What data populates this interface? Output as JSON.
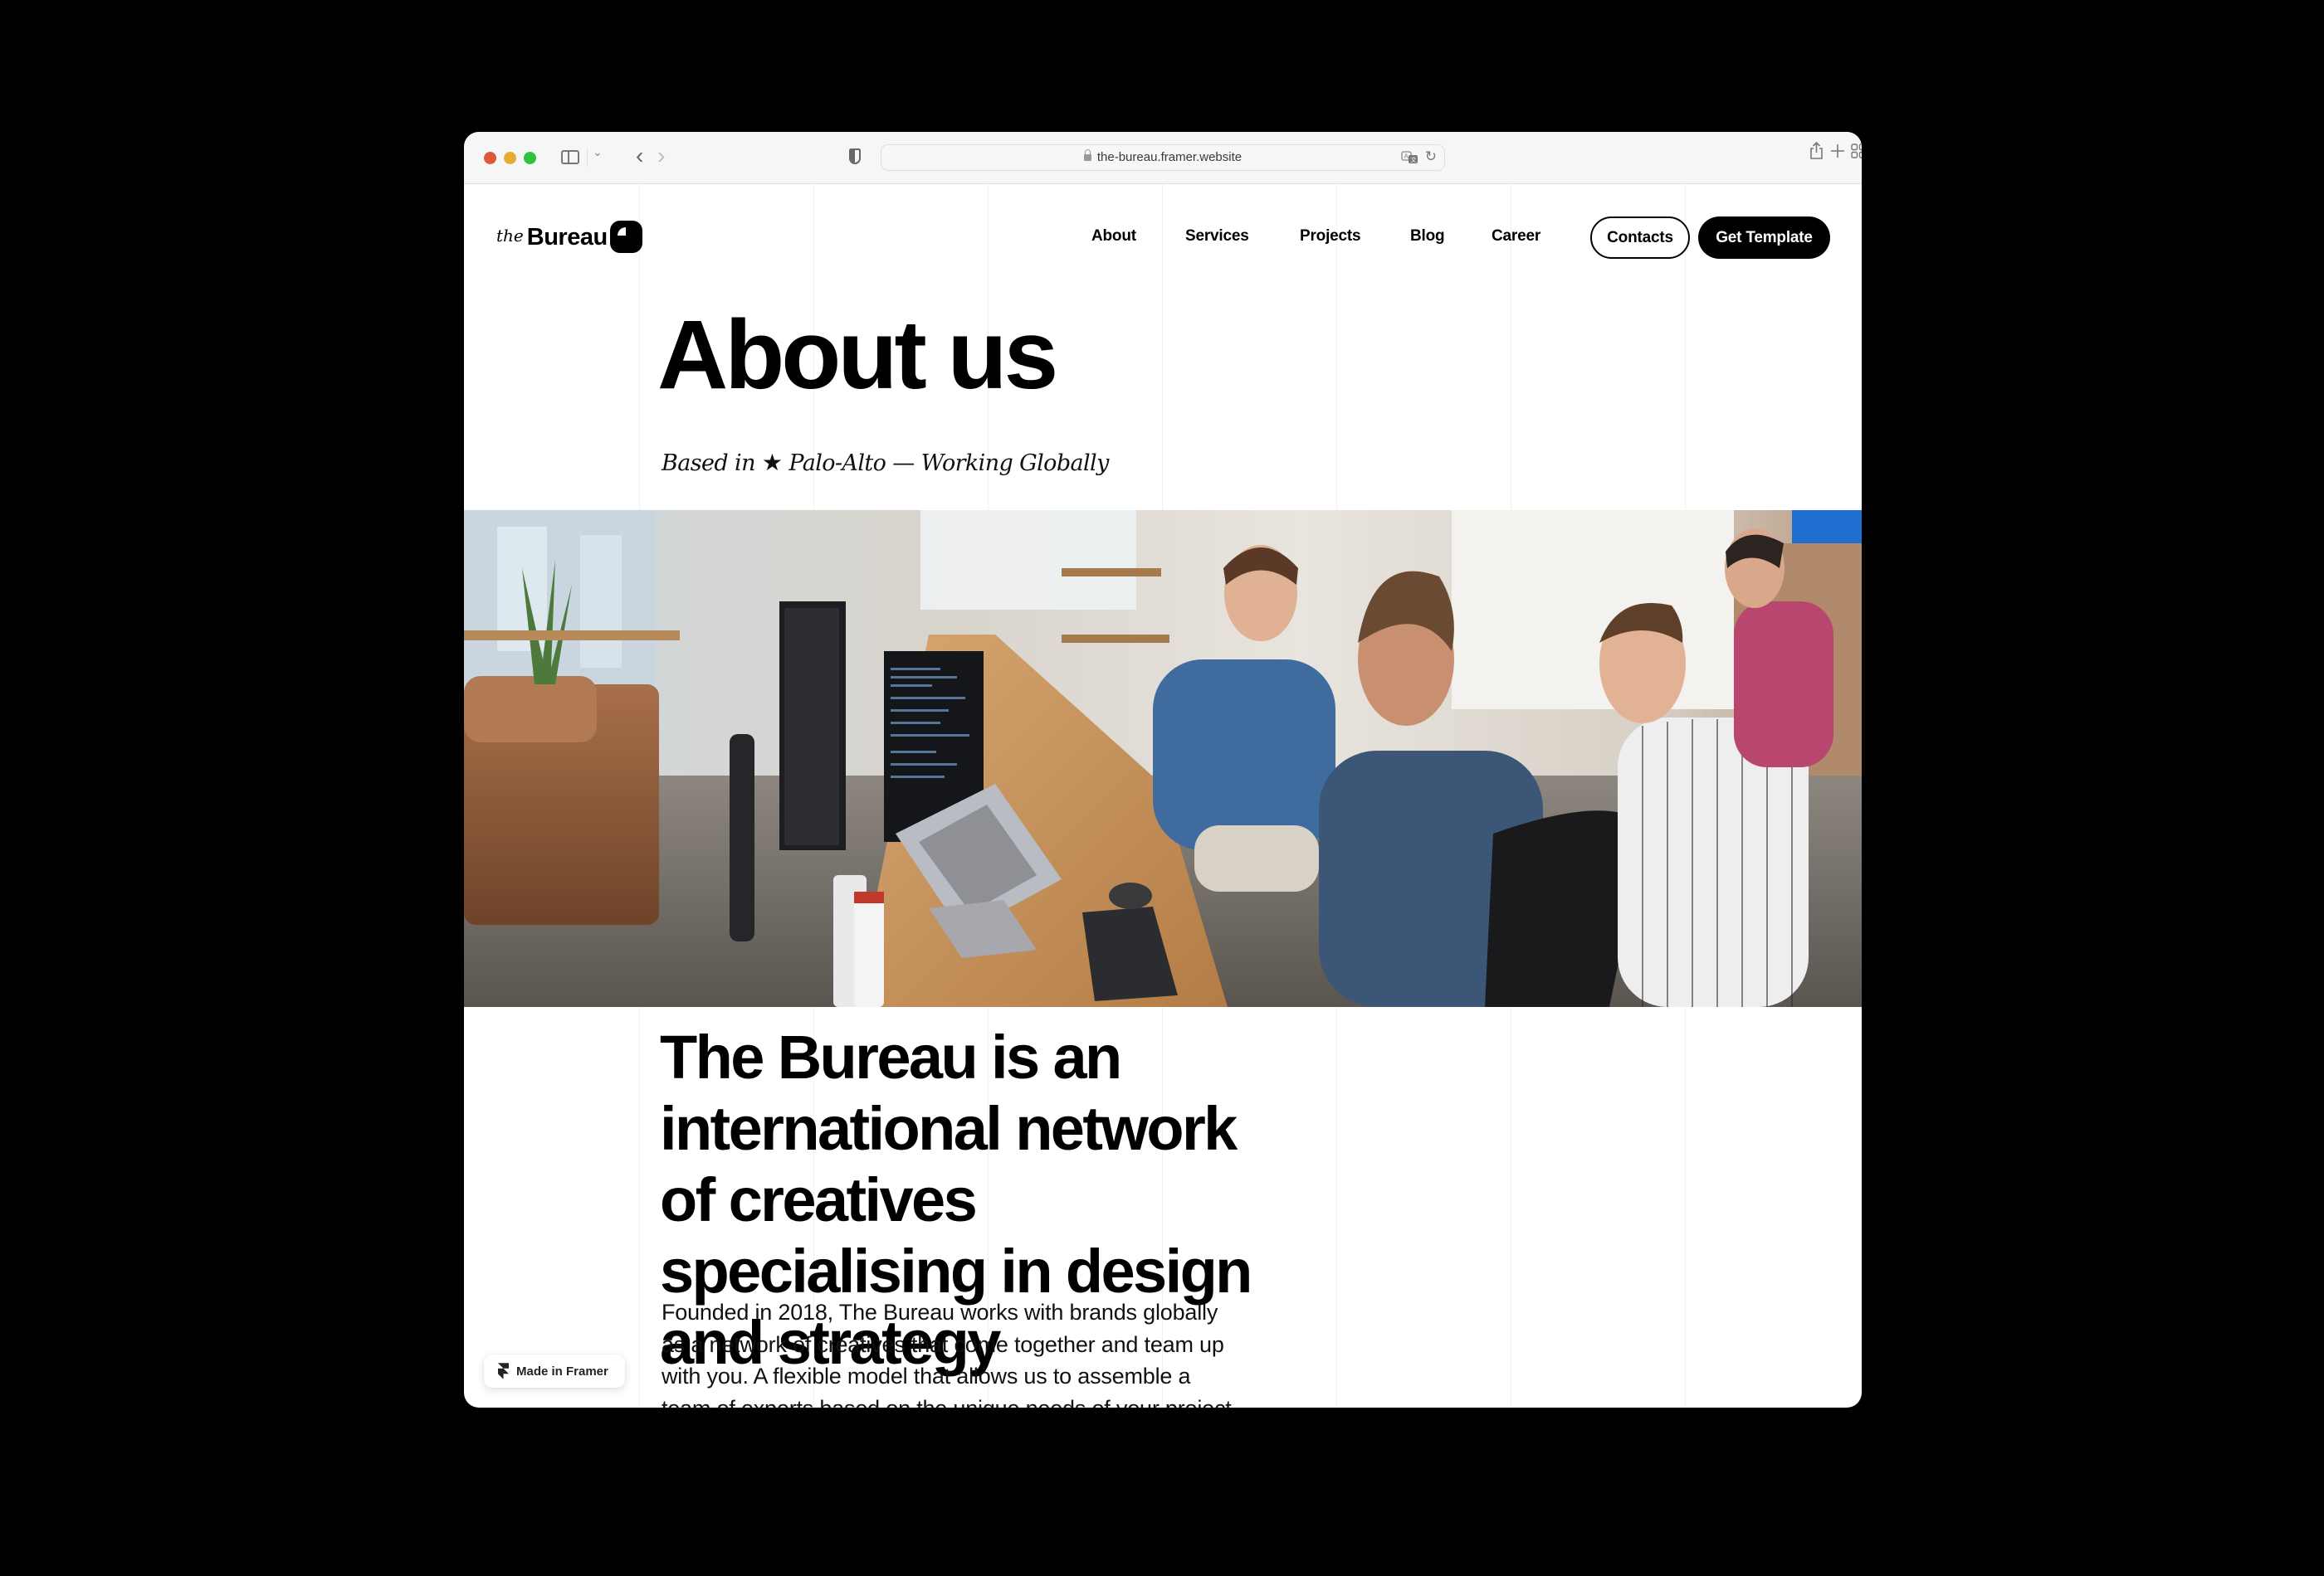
{
  "browser": {
    "url": "the-bureau.framer.website",
    "icons": [
      "sidebar-icon",
      "chevron-down-icon",
      "back-icon",
      "forward-icon",
      "shield-icon",
      "lock-icon",
      "translate-icon",
      "reload-icon",
      "share-icon",
      "new-tab-icon",
      "tab-overview-icon"
    ]
  },
  "header": {
    "logo_prefix": "the",
    "logo_name": "Bureau",
    "nav": [
      {
        "label": "About"
      },
      {
        "label": "Services"
      },
      {
        "label": "Projects"
      },
      {
        "label": "Blog"
      },
      {
        "label": "Career"
      }
    ],
    "contacts_label": "Contacts",
    "cta_label": "Get Template"
  },
  "hero": {
    "title": "About us",
    "subtitle_before": "Based in",
    "subtitle_star": "★",
    "subtitle_after": "Palo-Alto — Working Globally",
    "image_alt": "Team of colleagues talking at desks in an open office"
  },
  "intro": {
    "headline": "The Bureau is an international network of creatives specialising in design and strategy",
    "body": "Founded in 2018, The Bureau works with brands globally as a network of creatives that come together and team up with you.  A flexible model that allows us to assemble a team of experts based on the unique needs of your project."
  },
  "badge": {
    "label": "Made in Framer"
  },
  "colors": {
    "text": "#000000",
    "background": "#ffffff",
    "cta_bg": "#000000",
    "cta_text": "#ffffff"
  }
}
